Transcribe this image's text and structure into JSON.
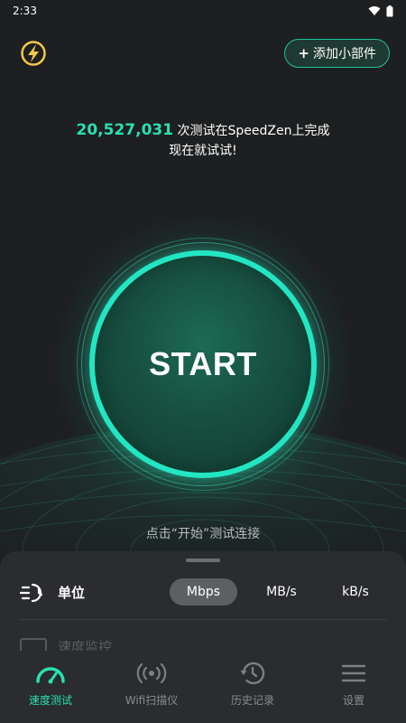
{
  "status_bar": {
    "time": "2:33"
  },
  "header": {
    "widget_button": {
      "plus": "+",
      "label": "添加小部件"
    }
  },
  "headline": {
    "count": "20,527,031",
    "line1_suffix": " 次测试在SpeedZen上完成",
    "line2": "现在就试试!"
  },
  "start_button": {
    "label": "START"
  },
  "hint": "点击“开始”测试连接",
  "settings": {
    "unit_label": "单位",
    "units": [
      "Mbps",
      "MB/s",
      "kB/s"
    ],
    "selected_unit": "Mbps",
    "partial_item_label": "速度监控"
  },
  "tabs": [
    {
      "label": "速度测试",
      "icon": "speedometer-icon",
      "active": true
    },
    {
      "label": "Wifi扫描仪",
      "icon": "wifi-signal-icon",
      "active": false
    },
    {
      "label": "历史记录",
      "icon": "history-icon",
      "active": false
    },
    {
      "label": "设置",
      "icon": "menu-icon",
      "active": false
    }
  ],
  "colors": {
    "accent": "#2ae0b0",
    "ring": "#22e6c2",
    "background": "#1d1f21",
    "sheet": "#2a2c2f"
  }
}
